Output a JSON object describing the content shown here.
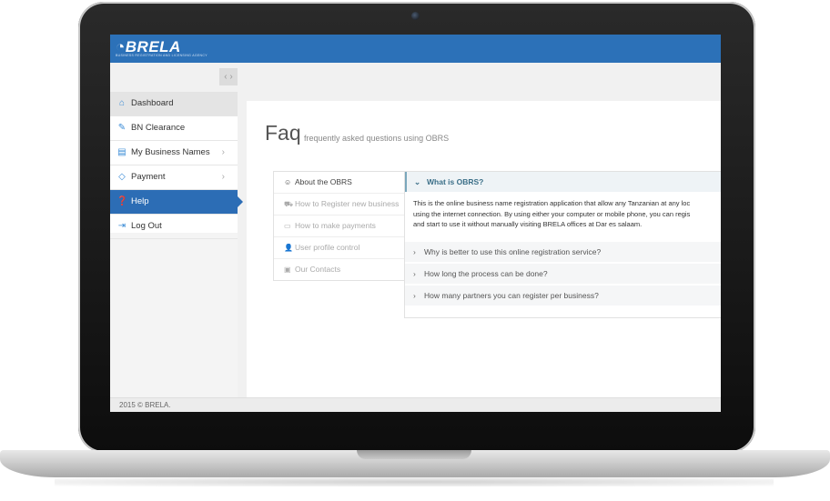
{
  "brand": {
    "logo": "BRELA",
    "tagline": "BUSINESS REGISTRATION AND LICENSING AGENCY"
  },
  "sidebar": {
    "items": [
      {
        "label": "Dashboard",
        "icon": "home-icon",
        "state": "hover"
      },
      {
        "label": "BN Clearance",
        "icon": "edit-icon"
      },
      {
        "label": "My Business Names",
        "icon": "document-icon",
        "has_chevron": true
      },
      {
        "label": "Payment",
        "icon": "tag-icon",
        "has_chevron": true
      },
      {
        "label": "Help",
        "icon": "question-icon",
        "state": "active"
      },
      {
        "label": "Log Out",
        "icon": "logout-icon"
      }
    ]
  },
  "page": {
    "title": "Faq",
    "subtitle": "frequently asked questions using OBRS"
  },
  "tabs": [
    {
      "label": "About the OBRS",
      "icon": "smile-icon",
      "active": true
    },
    {
      "label": "How to Register new business",
      "icon": "cart-icon"
    },
    {
      "label": "How to make payments",
      "icon": "money-icon"
    },
    {
      "label": "User profile control",
      "icon": "user-icon"
    },
    {
      "label": "Our Contacts",
      "icon": "contact-icon"
    }
  ],
  "faq": {
    "open_question": "What is OBRS?",
    "open_answer": [
      "This is the online business name registration application that allow any Tanzanian at any loc",
      "using the internet connection. By using either your computer or mobile phone, you can regis",
      "and start to use it without manually visiting BRELA offices at Dar es salaam."
    ],
    "questions": [
      "Why is better to use this online registration service?",
      "How long the process can be done?",
      "How many partners you can register per business?"
    ]
  },
  "footer": {
    "text": "2015 © BRELA."
  },
  "colors": {
    "header_blue": "#2c71b8",
    "active_menu": "#2c6db5"
  }
}
